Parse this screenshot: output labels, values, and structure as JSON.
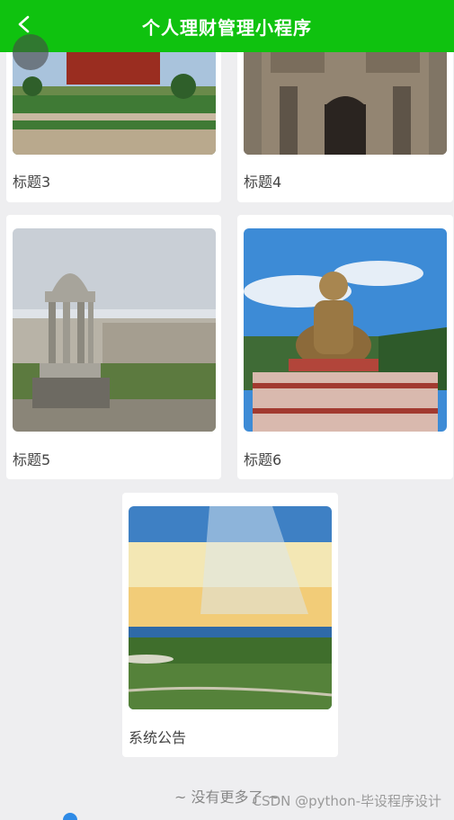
{
  "header": {
    "title": "个人理财管理小程序",
    "back_icon": "chevron-left-icon"
  },
  "cards": [
    {
      "label": "标题3"
    },
    {
      "label": "标题4"
    },
    {
      "label": "标题5"
    },
    {
      "label": "标题6"
    },
    {
      "label": "系统公告"
    }
  ],
  "footer": {
    "no_more": "~ 没有更多了 ~",
    "watermark": "CSDN @python-毕设程序设计"
  },
  "colors": {
    "header_bg": "#0fc20f",
    "page_bg": "#eeeef0"
  }
}
